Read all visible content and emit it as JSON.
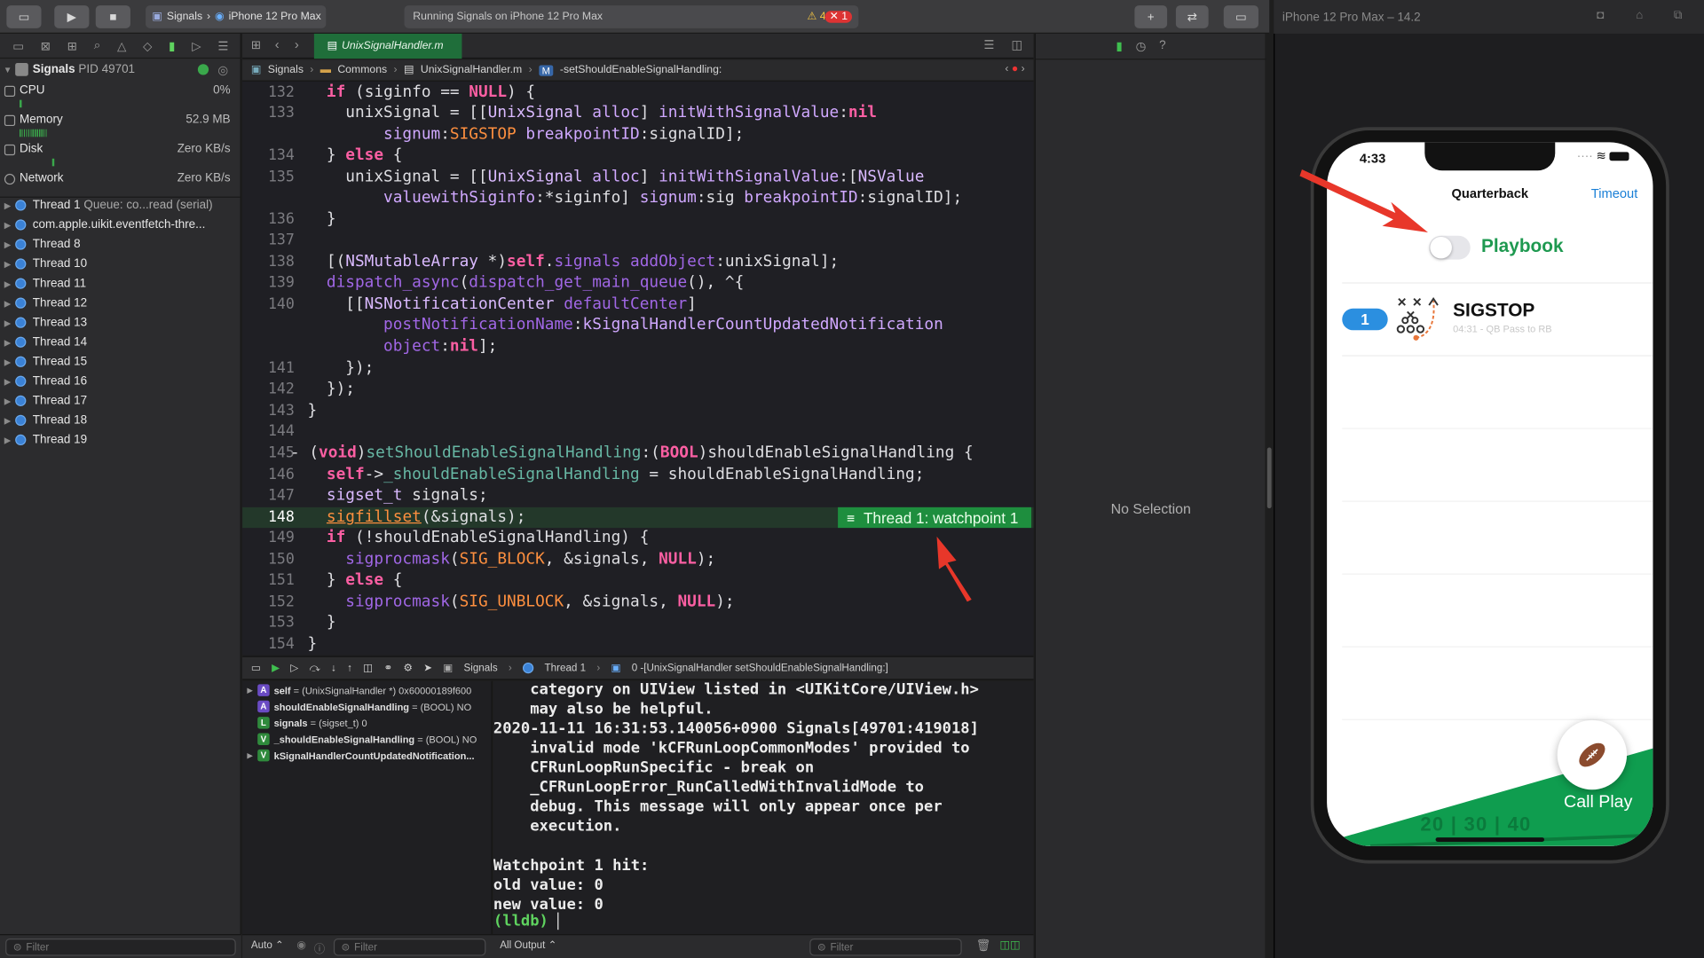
{
  "toolbar": {
    "scheme": "Signals",
    "device": "iPhone 12 Pro Max",
    "activity": "Running Signals on iPhone 12 Pro Max",
    "warnings": "4",
    "errors": "1"
  },
  "navigator": {
    "process": "Signals",
    "pid": "PID 49701",
    "gauges": [
      {
        "name": "CPU",
        "value": "0%"
      },
      {
        "name": "Memory",
        "value": "52.9 MB"
      },
      {
        "name": "Disk",
        "value": "Zero KB/s"
      },
      {
        "name": "Network",
        "value": "Zero KB/s"
      }
    ],
    "threads": [
      "Thread 1",
      "com.apple.uikit.eventfetch-thre...",
      "Thread 8",
      "Thread 10",
      "Thread 11",
      "Thread 12",
      "Thread 13",
      "Thread 14",
      "Thread 15",
      "Thread 16",
      "Thread 17",
      "Thread 18",
      "Thread 19"
    ],
    "thread1_queue": "Queue: co...read (serial)",
    "filter_placeholder": "Filter"
  },
  "editor": {
    "tab": "UnixSignalHandler.m",
    "jump": [
      "Signals",
      "Commons",
      "UnixSignalHandler.m",
      "-setShouldEnableSignalHandling:"
    ],
    "watchpoint_label": "Thread 1: watchpoint 1",
    "line_numbers": [
      "132",
      "133",
      "134",
      "135",
      "136",
      "137",
      "138",
      "139",
      "140",
      "141",
      "142",
      "143",
      "144",
      "145",
      "146",
      "147",
      "148",
      "149",
      "150",
      "151",
      "152",
      "153",
      "154"
    ]
  },
  "debugbar": {
    "crumbs": [
      "Signals",
      "Thread 1",
      "0 -[UnixSignalHandler setShouldEnableSignalHandling:]"
    ]
  },
  "variables": [
    {
      "kind": "A",
      "name": "self",
      "detail": "= (UnixSignalHandler *) 0x60000189f600"
    },
    {
      "kind": "A",
      "name": "shouldEnableSignalHandling",
      "detail": "= (BOOL) NO"
    },
    {
      "kind": "L",
      "name": "signals",
      "detail": "= (sigset_t) 0"
    },
    {
      "kind": "V",
      "name": "_shouldEnableSignalHandling",
      "detail": "= (BOOL) NO"
    },
    {
      "kind": "V",
      "name": "kSignalHandlerCountUpdatedNotification...",
      "detail": ""
    }
  ],
  "console": {
    "lines": [
      "    category on UIView listed in <UIKitCore/UIView.h>",
      "    may also be helpful.",
      "2020-11-11 16:31:53.140056+0900 Signals[49701:419018]",
      "    invalid mode 'kCFRunLoopCommonModes' provided to",
      "    CFRunLoopRunSpecific - break on",
      "    _CFRunLoopError_RunCalledWithInvalidMode to",
      "    debug. This message will only appear once per",
      "    execution.",
      "",
      "Watchpoint 1 hit:",
      "old value: 0",
      "new value: 0"
    ],
    "prompt": "(lldb)",
    "output_mode": "All Output",
    "filter_placeholder": "Filter",
    "auto": "Auto"
  },
  "inspector": {
    "no_selection": "No Selection"
  },
  "simulator": {
    "title": "iPhone 12 Pro Max – 14.2",
    "time": "4:33",
    "nav_title": "Quarterback",
    "nav_right": "Timeout",
    "toggle_label": "Playbook",
    "row_badge": "1",
    "row_title": "SIGSTOP",
    "row_subtitle": "04:31 - QB Pass to RB",
    "call_play": "Call Play",
    "yard_marks": [
      "20",
      "30",
      "40"
    ]
  },
  "colors": {
    "accent_green": "#1e8e3e",
    "arrow_red": "#e8372a",
    "ios_blue": "#1a7fd6",
    "field_green": "#0f9d4f"
  }
}
